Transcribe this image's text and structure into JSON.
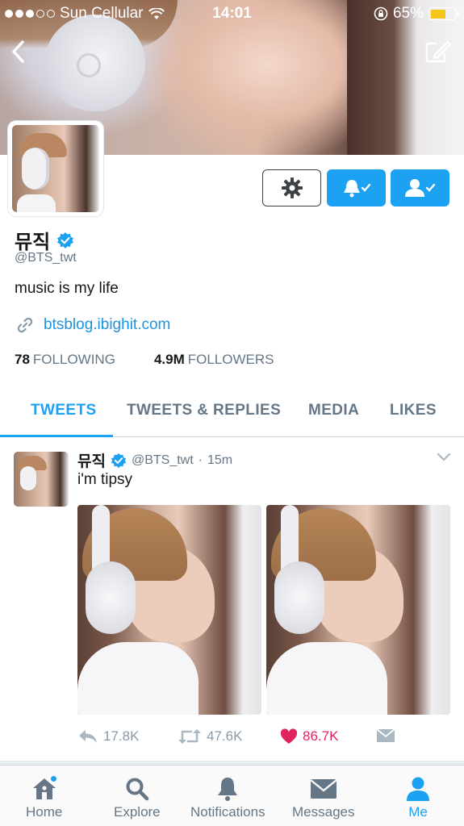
{
  "status_bar": {
    "carrier": "Sun Cellular",
    "time": "14:01",
    "battery": "65%",
    "battery_color": "#f5c518"
  },
  "header": {
    "back_icon": "chevron-left-icon",
    "compose_icon": "compose-icon"
  },
  "profile": {
    "display_name": "뮤직",
    "verified": true,
    "handle": "@BTS_twt",
    "bio": "music is my life",
    "link": "btsblog.ibighit.com",
    "following_count": "78",
    "following_label": "FOLLOWING",
    "followers_count": "4.9M",
    "followers_label": "FOLLOWERS",
    "buttons": [
      "gear-icon",
      "notifications-on-icon",
      "following-icon"
    ]
  },
  "tabs": [
    {
      "label": "TWEETS",
      "active": true
    },
    {
      "label": "TWEETS & REPLIES",
      "active": false
    },
    {
      "label": "MEDIA",
      "active": false
    },
    {
      "label": "LIKES",
      "active": false
    }
  ],
  "tweet": {
    "name": "뮤직",
    "handle": "@BTS_twt",
    "time": "15m",
    "text": "i'm tipsy",
    "replies": "17.8K",
    "retweets": "47.6K",
    "likes": "86.7K",
    "liked": true
  },
  "bottom_nav": [
    {
      "label": "Home",
      "icon": "home-icon",
      "active": false,
      "unread": true
    },
    {
      "label": "Explore",
      "icon": "search-icon",
      "active": false
    },
    {
      "label": "Notifications",
      "icon": "bell-icon",
      "active": false
    },
    {
      "label": "Messages",
      "icon": "envelope-icon",
      "active": false
    },
    {
      "label": "Me",
      "icon": "person-icon",
      "active": true
    }
  ],
  "colors": {
    "accent": "#1da1f2",
    "link": "#1b95e0",
    "like": "#e0245e",
    "muted": "#657786"
  }
}
